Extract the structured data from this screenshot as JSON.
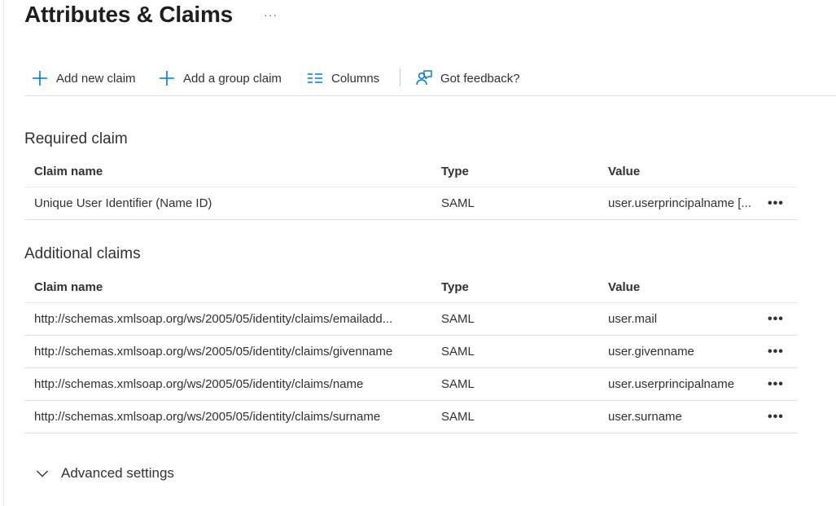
{
  "page": {
    "title": "Attributes & Claims",
    "more": "···"
  },
  "toolbar": {
    "add_claim": "Add new claim",
    "add_group_claim": "Add a group claim",
    "columns": "Columns",
    "feedback": "Got feedback?"
  },
  "required": {
    "title": "Required claim",
    "headers": {
      "name": "Claim name",
      "type": "Type",
      "value": "Value"
    },
    "rows": [
      {
        "name": "Unique User Identifier (Name ID)",
        "type": "SAML",
        "value": "user.userprincipalname [...",
        "more": "•••"
      }
    ]
  },
  "additional": {
    "title": "Additional claims",
    "headers": {
      "name": "Claim name",
      "type": "Type",
      "value": "Value"
    },
    "rows": [
      {
        "name": "http://schemas.xmlsoap.org/ws/2005/05/identity/claims/emailadd...",
        "type": "SAML",
        "value": "user.mail",
        "more": "•••"
      },
      {
        "name": "http://schemas.xmlsoap.org/ws/2005/05/identity/claims/givenname",
        "type": "SAML",
        "value": "user.givenname",
        "more": "•••"
      },
      {
        "name": "http://schemas.xmlsoap.org/ws/2005/05/identity/claims/name",
        "type": "SAML",
        "value": "user.userprincipalname",
        "more": "•••"
      },
      {
        "name": "http://schemas.xmlsoap.org/ws/2005/05/identity/claims/surname",
        "type": "SAML",
        "value": "user.surname",
        "more": "•••"
      }
    ]
  },
  "advanced": {
    "label": "Advanced settings"
  },
  "colors": {
    "accent": "#0078d4",
    "text": "#323130",
    "divider": "#e1dfdd"
  },
  "icons": {
    "add": "plus-icon",
    "columns": "columns-icon",
    "feedback": "feedback-icon",
    "more": "ellipsis-icon",
    "expand": "chevron-down-icon"
  }
}
